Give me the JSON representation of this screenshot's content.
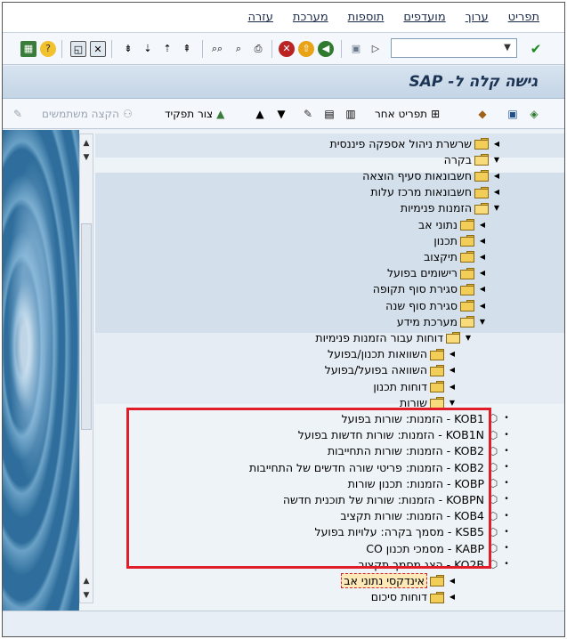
{
  "menu": {
    "items": [
      "תפריט",
      "ערוך",
      "מועדפים",
      "תוספות",
      "מערכת",
      "עזרה"
    ]
  },
  "toolbar": {
    "command_value": "",
    "icons": [
      "check-icon",
      "save-icon",
      "back-icon",
      "exit-icon",
      "cancel-icon",
      "print-icon",
      "find-icon",
      "find-next-icon",
      "first-page-icon",
      "prev-page-icon",
      "next-page-icon",
      "last-page-icon",
      "new-session-icon",
      "shortcut-icon",
      "help-icon",
      "layout-icon"
    ]
  },
  "title": "גישה קלה ל- SAP",
  "appbar": {
    "other_menu": "תפריט אחר",
    "create_role": "צור תפקיד",
    "assign_users": "הקצה משתמשים"
  },
  "tree": [
    {
      "label": "שרשרת ניהול אספקה פיננסית",
      "level": 0,
      "type": "folder",
      "state": "collapsed"
    },
    {
      "label": "בקרה",
      "level": 0,
      "type": "folder",
      "state": "expanded"
    },
    {
      "label": "חשבונאות סעיף הוצאה",
      "level": 1,
      "type": "folder",
      "state": "collapsed"
    },
    {
      "label": "חשבונאות מרכז עלות",
      "level": 1,
      "type": "folder",
      "state": "collapsed"
    },
    {
      "label": "הזמנות פנימיות",
      "level": 1,
      "type": "folder",
      "state": "expanded"
    },
    {
      "label": "נתוני אב",
      "level": 2,
      "type": "folder",
      "state": "collapsed"
    },
    {
      "label": "תכנון",
      "level": 2,
      "type": "folder",
      "state": "collapsed"
    },
    {
      "label": "תיקצוב",
      "level": 2,
      "type": "folder",
      "state": "collapsed"
    },
    {
      "label": "רישומים בפועל",
      "level": 2,
      "type": "folder",
      "state": "collapsed"
    },
    {
      "label": "סגירת סוף תקופה",
      "level": 2,
      "type": "folder",
      "state": "collapsed"
    },
    {
      "label": "סגירת סוף שנה",
      "level": 2,
      "type": "folder",
      "state": "collapsed"
    },
    {
      "label": "מערכת מידע",
      "level": 2,
      "type": "folder",
      "state": "expanded"
    },
    {
      "label": "דוחות עבור הזמנות פנימיות",
      "level": 3,
      "type": "folder",
      "state": "expanded"
    },
    {
      "label": "השוואות תכנון/בפועל",
      "level": 4,
      "type": "folder",
      "state": "collapsed"
    },
    {
      "label": "השוואה בפועל/בפועל",
      "level": 4,
      "type": "folder",
      "state": "collapsed"
    },
    {
      "label": "דוחות תכנון",
      "level": 4,
      "type": "folder",
      "state": "collapsed"
    },
    {
      "label": "שורות",
      "level": 4,
      "type": "folder",
      "state": "expanded"
    },
    {
      "label": "KOB1 - הזמנות: שורות בפועל",
      "level": 5,
      "type": "transaction"
    },
    {
      "label": "KOB1N - הזמנות: שורות חדשות בפועל",
      "level": 5,
      "type": "transaction"
    },
    {
      "label": "KOB2 - הזמנות: שורות התחייבות",
      "level": 5,
      "type": "transaction"
    },
    {
      "label": "KOB2 - הזמנות: פריטי שורה חדשים של התחייבות",
      "level": 5,
      "type": "transaction"
    },
    {
      "label": "KOBP - הזמנות: תכנון שורות",
      "level": 5,
      "type": "transaction"
    },
    {
      "label": "KOBPN - הזמנות: שורות של תוכנית חדשה",
      "level": 5,
      "type": "transaction"
    },
    {
      "label": "KOB4 - הזמנות: שורות תקציב",
      "level": 5,
      "type": "transaction"
    },
    {
      "label": "KSB5 - מסמך בקרה: עלויות בפועל",
      "level": 5,
      "type": "transaction"
    },
    {
      "label": "KABP - מסמכי תכנון CO",
      "level": 5,
      "type": "transaction"
    },
    {
      "label": "KO2B - הצג מסמך תקציב",
      "level": 5,
      "type": "transaction"
    },
    {
      "label": "אינדקסי נתוני אב",
      "level": 4,
      "type": "folder",
      "state": "collapsed",
      "selected": true
    },
    {
      "label": "דוחות סיכום",
      "level": 4,
      "type": "folder",
      "state": "collapsed"
    }
  ]
}
